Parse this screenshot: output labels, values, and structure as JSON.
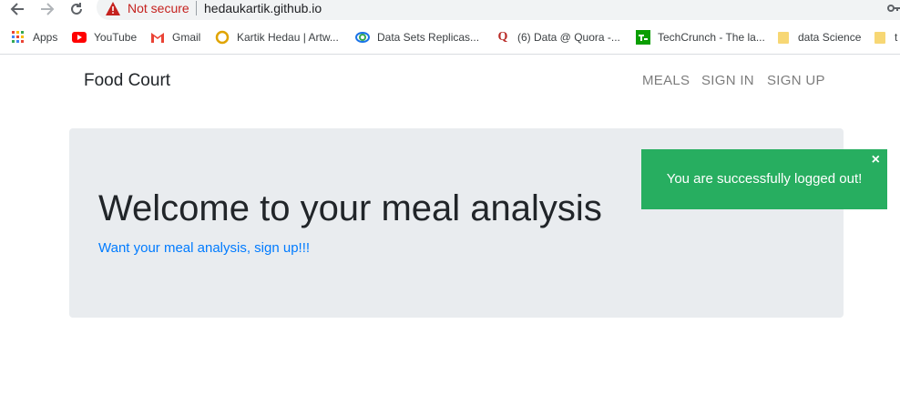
{
  "browser": {
    "security_label": "Not secure",
    "url": "hedaukartik.github.io"
  },
  "bookmarks": [
    {
      "label": "Apps",
      "icon": "apps-grid-icon"
    },
    {
      "label": "YouTube",
      "icon": "youtube-icon"
    },
    {
      "label": "Gmail",
      "icon": "gmail-icon"
    },
    {
      "label": "Kartik Hedau | Artw...",
      "icon": "circle-logo-icon"
    },
    {
      "label": "Data Sets Replicas...",
      "icon": "rings-logo-icon"
    },
    {
      "label": "(6) Data @ Quora -...",
      "icon": "quora-icon"
    },
    {
      "label": "TechCrunch - The la...",
      "icon": "techcrunch-icon"
    },
    {
      "label": "data Science",
      "icon": "folder-icon"
    },
    {
      "label": "t",
      "icon": "folder-icon"
    }
  ],
  "navbar": {
    "brand": "Food Court",
    "links": [
      "MEALS",
      "SIGN IN",
      "SIGN UP"
    ]
  },
  "hero": {
    "title": "Welcome to your meal analysis",
    "link_text": "Want your meal analysis, sign up!!!"
  },
  "toast": {
    "message": "You are successfully logged out!",
    "close": "×"
  },
  "colors": {
    "toast_bg": "#27ae60",
    "link": "#007bff",
    "jumbotron_bg": "#e9ecef"
  }
}
